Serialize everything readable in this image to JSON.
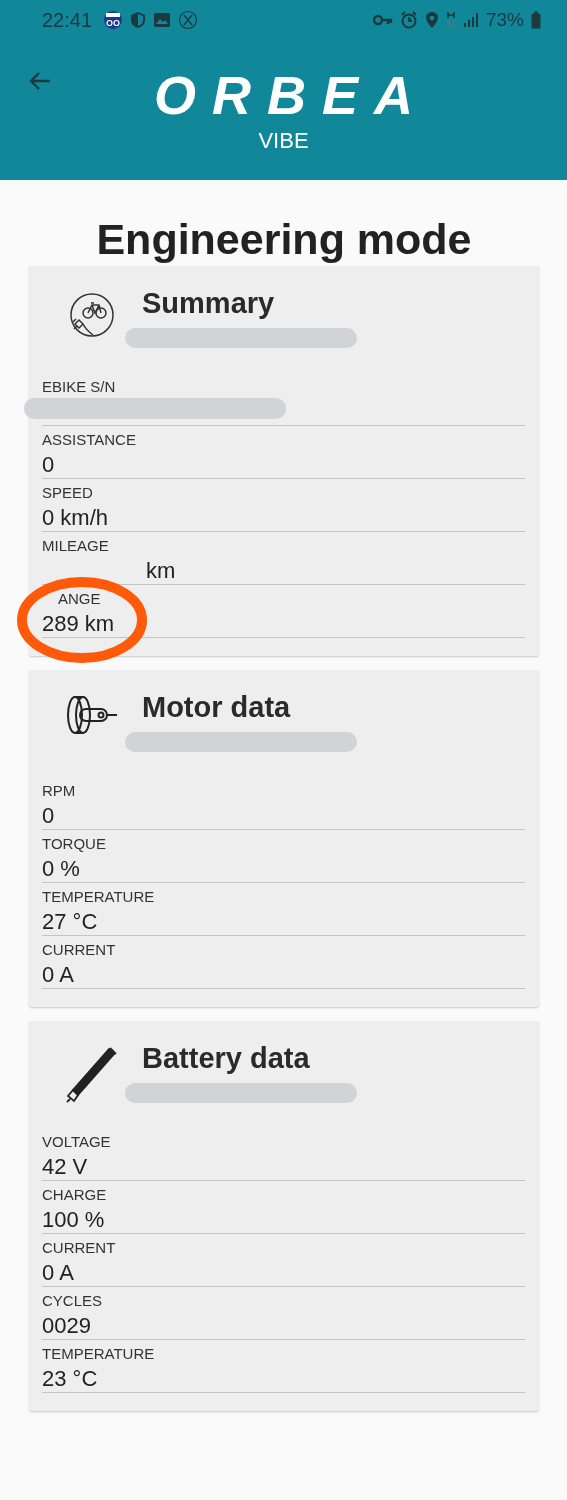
{
  "status_bar": {
    "time": "22:41",
    "battery": "73%"
  },
  "header": {
    "logo": "ORBEA",
    "subtitle": "VIBE"
  },
  "title": "Engineering mode",
  "sections": [
    {
      "title": "Summary",
      "kind": "ebike",
      "fields": [
        {
          "label": "EBIKE S/N",
          "kind": "redacted"
        },
        {
          "label": "ASSISTANCE",
          "value": "0",
          "kind": "text"
        },
        {
          "label": "SPEED",
          "value": "0 km/h",
          "kind": "text"
        },
        {
          "label": "MILEAGE",
          "value": "km",
          "kind": "value_covered"
        },
        {
          "label": "ANGE",
          "value": "289 km",
          "kind": "label_covered"
        }
      ]
    },
    {
      "title": "Motor data",
      "kind": "motor",
      "fields": [
        {
          "label": "RPM",
          "value": "0",
          "kind": "text"
        },
        {
          "label": "TORQUE",
          "value": "0 %",
          "kind": "text"
        },
        {
          "label": "TEMPERATURE",
          "value": "27 °C",
          "kind": "text"
        },
        {
          "label": "CURRENT",
          "value": "0 A",
          "kind": "text"
        }
      ]
    },
    {
      "title": "Battery data",
      "kind": "battery",
      "fields": [
        {
          "label": "VOLTAGE",
          "value": "42 V",
          "kind": "text"
        },
        {
          "label": "CHARGE",
          "value": "100 %",
          "kind": "text"
        },
        {
          "label": "CURRENT",
          "value": "0 A",
          "kind": "text"
        },
        {
          "label": "CYCLES",
          "value": "0029",
          "kind": "text"
        },
        {
          "label": "TEMPERATURE",
          "value": "23 °C",
          "kind": "text"
        }
      ]
    }
  ],
  "annotation": {
    "kind": "circle",
    "color": "#ff5a0a"
  }
}
